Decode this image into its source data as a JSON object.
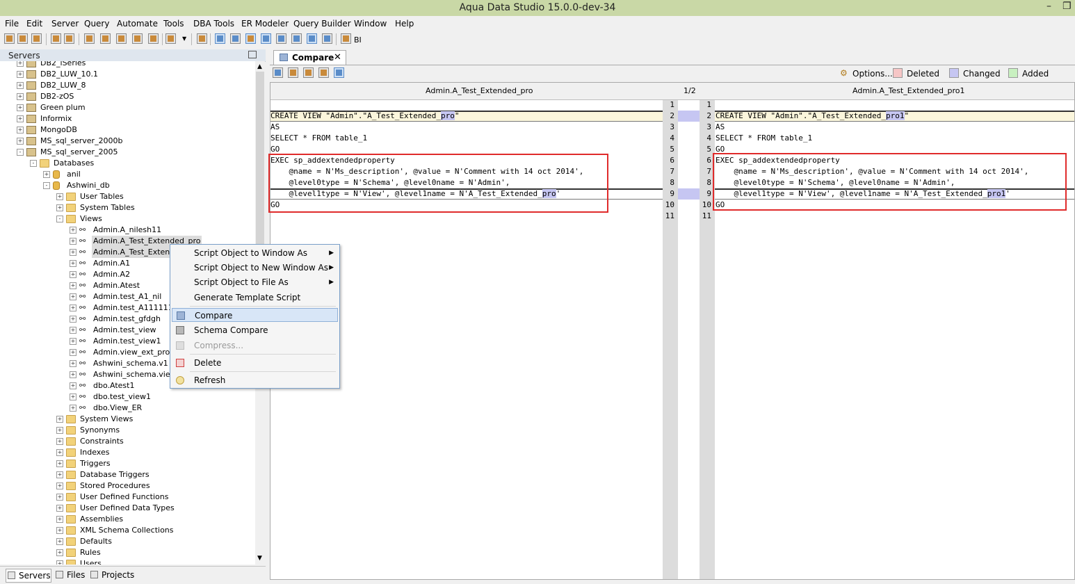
{
  "window": {
    "title": "Aqua Data Studio 15.0.0-dev-34",
    "minimize": "–",
    "restore": "❐"
  },
  "menu": [
    "File",
    "Edit",
    "Server",
    "Query",
    "Automate",
    "Tools",
    "DBA Tools",
    "ER Modeler",
    "Query Builder",
    "Window",
    "Help"
  ],
  "toolbar": {
    "bi_label": "BI"
  },
  "servers_panel": {
    "title": "Servers",
    "tree": [
      {
        "label": "DB2_iSeries",
        "kind": "server"
      },
      {
        "label": "DB2_LUW_10.1",
        "kind": "server"
      },
      {
        "label": "DB2_LUW_8",
        "kind": "server"
      },
      {
        "label": "DB2-zOS",
        "kind": "server"
      },
      {
        "label": "Green plum",
        "kind": "server"
      },
      {
        "label": "Informix",
        "kind": "server"
      },
      {
        "label": "MongoDB",
        "kind": "server"
      },
      {
        "label": "MS_sql_server_2000b",
        "kind": "server"
      },
      {
        "label": "MS_sql_server_2005",
        "kind": "server"
      },
      {
        "label": "Databases",
        "kind": "folder"
      },
      {
        "label": "anil",
        "kind": "db"
      },
      {
        "label": "Ashwini_db",
        "kind": "db"
      },
      {
        "label": "User Tables",
        "kind": "folder"
      },
      {
        "label": "System Tables",
        "kind": "folder"
      },
      {
        "label": "Views",
        "kind": "folder"
      },
      {
        "label": "Admin.A_nilesh11",
        "kind": "view"
      },
      {
        "label": "Admin.A_Test_Extended_pro",
        "kind": "view"
      },
      {
        "label": "Admin.A_Test_Extended_pro1",
        "kind": "view"
      },
      {
        "label": "Admin.A1",
        "kind": "view"
      },
      {
        "label": "Admin.A2",
        "kind": "view"
      },
      {
        "label": "Admin.Atest",
        "kind": "view"
      },
      {
        "label": "Admin.test_A1_nil",
        "kind": "view"
      },
      {
        "label": "Admin.test_A111111",
        "kind": "view"
      },
      {
        "label": "Admin.test_gfdgh",
        "kind": "view"
      },
      {
        "label": "Admin.test_view",
        "kind": "view"
      },
      {
        "label": "Admin.test_view1",
        "kind": "view"
      },
      {
        "label": "Admin.view_ext_prop",
        "kind": "view"
      },
      {
        "label": "Ashwini_schema.v1",
        "kind": "view"
      },
      {
        "label": "Ashwini_schema.view1",
        "kind": "view"
      },
      {
        "label": "dbo.Atest1",
        "kind": "view"
      },
      {
        "label": "dbo.test_view1",
        "kind": "view"
      },
      {
        "label": "dbo.View_ER",
        "kind": "view"
      },
      {
        "label": "System Views",
        "kind": "folder"
      },
      {
        "label": "Synonyms",
        "kind": "folder"
      },
      {
        "label": "Constraints",
        "kind": "folder"
      },
      {
        "label": "Indexes",
        "kind": "folder"
      },
      {
        "label": "Triggers",
        "kind": "folder"
      },
      {
        "label": "Database Triggers",
        "kind": "folder"
      },
      {
        "label": "Stored Procedures",
        "kind": "folder"
      },
      {
        "label": "User Defined Functions",
        "kind": "folder"
      },
      {
        "label": "User Defined Data Types",
        "kind": "folder"
      },
      {
        "label": "Assemblies",
        "kind": "folder"
      },
      {
        "label": "XML Schema Collections",
        "kind": "folder"
      },
      {
        "label": "Defaults",
        "kind": "folder"
      },
      {
        "label": "Rules",
        "kind": "folder"
      },
      {
        "label": "Users",
        "kind": "folder"
      }
    ]
  },
  "bottom_tabs": [
    "Servers",
    "Files",
    "Projects"
  ],
  "context_menu": {
    "items": [
      {
        "label": "Script Object to Window As",
        "submenu": true
      },
      {
        "label": "Script Object to New Window As",
        "submenu": true
      },
      {
        "label": "Script Object to File As",
        "submenu": true
      },
      {
        "label": "Generate Template Script"
      },
      {
        "label": "Compare",
        "selected": true
      },
      {
        "label": "Schema Compare"
      },
      {
        "label": "Compress...",
        "disabled": true
      },
      {
        "label": "Delete"
      },
      {
        "label": "Refresh"
      }
    ]
  },
  "compare": {
    "tab_label": "Compare",
    "options_label": "Options...",
    "legend": [
      {
        "label": "Deleted",
        "color": "#f6c6c6"
      },
      {
        "label": "Changed",
        "color": "#c6c6f2"
      },
      {
        "label": "Added",
        "color": "#c8f0c0"
      }
    ],
    "left_title": "Admin.A_Test_Extended_pro",
    "right_title": "Admin.A_Test_Extended_pro1",
    "diff_position": "1/2",
    "left_lines": [
      {
        "n": "1",
        "text": ""
      },
      {
        "n": "2",
        "text": "CREATE VIEW \"Admin\".\"A_Test_Extended_",
        "hl": "pro",
        "after": "\""
      },
      {
        "n": "3",
        "text": "AS"
      },
      {
        "n": "4",
        "text": "SELECT * FROM table_1"
      },
      {
        "n": "5",
        "text": "GO"
      },
      {
        "n": "6",
        "text": "EXEC sp_addextendedproperty"
      },
      {
        "n": "7",
        "text": "    @name = N'Ms_description', @value = N'Comment with 14 oct 2014',"
      },
      {
        "n": "8",
        "text": "    @level0type = N'Schema', @level0name = N'Admin',"
      },
      {
        "n": "9",
        "text": "    @level1type = N'View', @level1name = N'A_Test_Extended_",
        "hl": "pro",
        "after": "'"
      },
      {
        "n": "10",
        "text": "GO"
      },
      {
        "n": "11",
        "text": ""
      }
    ],
    "right_lines": [
      {
        "n": "1",
        "text": ""
      },
      {
        "n": "2",
        "text": "CREATE VIEW \"Admin\".\"A_Test_Extended_",
        "hl": "pro1",
        "after": "\""
      },
      {
        "n": "3",
        "text": "AS"
      },
      {
        "n": "4",
        "text": "SELECT * FROM table_1"
      },
      {
        "n": "5",
        "text": "GO"
      },
      {
        "n": "6",
        "text": "EXEC sp_addextendedproperty"
      },
      {
        "n": "7",
        "text": "    @name = N'Ms_description', @value = N'Comment with 14 oct 2014',"
      },
      {
        "n": "8",
        "text": "    @level0type = N'Schema', @level0name = N'Admin',"
      },
      {
        "n": "9",
        "text": "    @level1type = N'View', @level1name = N'A_Test_Extended_",
        "hl": "pro1",
        "after": "'"
      },
      {
        "n": "10",
        "text": "GO"
      },
      {
        "n": "11",
        "text": ""
      }
    ]
  }
}
